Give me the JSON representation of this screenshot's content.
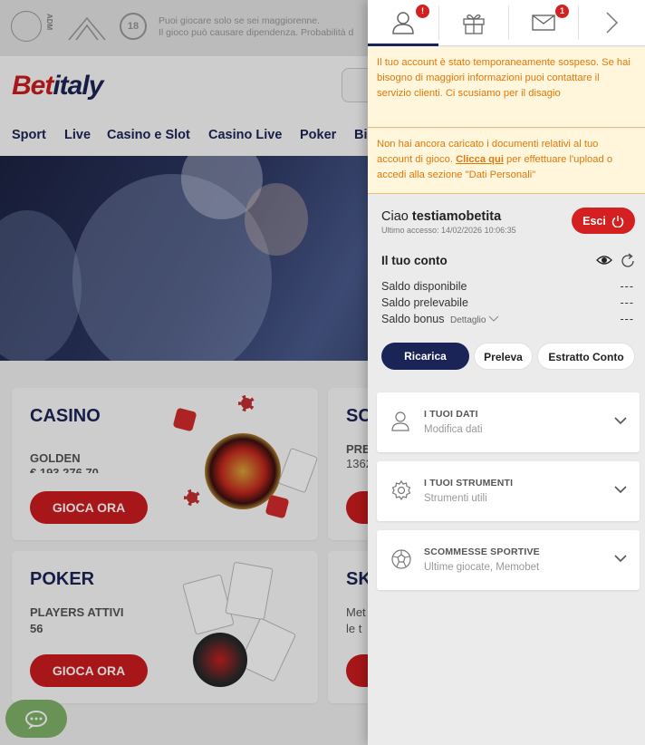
{
  "site": {
    "topbar": {
      "adm_label": "ADM",
      "age_badge": "18",
      "warning": "Puoi giocare solo se sei maggiorenne.\nIl gioco può causare dipendenza. Probabilità d"
    },
    "brand": {
      "part1": "Bet",
      "part2": "italy"
    },
    "nav": [
      "Sport",
      "Live",
      "Casino e Slot",
      "Casino Live",
      "Poker",
      "Bi"
    ],
    "cards": {
      "casino": {
        "title": "CASINO",
        "subtitle": "GOLDEN",
        "value": "€ 193.276,70",
        "button": "GIOCA ORA"
      },
      "sc": {
        "title": "SC",
        "subtitle": "PRE",
        "value": "1362"
      },
      "poker": {
        "title": "POKER",
        "subtitle": "PLAYERS ATTIVI",
        "value": "56",
        "button": "GIOCA ORA"
      },
      "sk": {
        "title": "SK",
        "line1": "Met",
        "line2": "le t"
      }
    }
  },
  "panel": {
    "tabs": [
      {
        "name": "account",
        "badge": "!"
      },
      {
        "name": "gift",
        "badge": ""
      },
      {
        "name": "messages",
        "badge": "1"
      },
      {
        "name": "next",
        "badge": ""
      }
    ],
    "notice1": "Il tuo account è stato temporaneamente sospeso. Se hai bisogno di maggiori informazioni puoi contattare il servizio clienti. Ci scusiamo per il disagio",
    "notice2": {
      "before": "Non hai ancora caricato i documenti relativi al tuo account di gioco.",
      "link": "Clicca qui",
      "after": "per effettuare l'upload o accedi alla sezione \"Dati Personali\""
    },
    "greeting": {
      "hello": "Ciao",
      "username": "testiamobetita",
      "last_access": "Ultimo accesso: 14/02/2026 10:06:35"
    },
    "logout_label": "Esci",
    "conto": {
      "title": "Il tuo conto",
      "rows": [
        {
          "label": "Saldo disponibile",
          "value": "---"
        },
        {
          "label": "Saldo prelevabile",
          "value": "---"
        },
        {
          "label": "Saldo bonus",
          "detail": "Dettaglio",
          "value": "---"
        }
      ]
    },
    "buttons": {
      "ricarica": "Ricarica",
      "preleva": "Preleva",
      "estratto": "Estratto Conto"
    },
    "sections": [
      {
        "title": "I TUOI DATI",
        "subtitle": "Modifica dati",
        "icon": "user-icon"
      },
      {
        "title": "I TUOI STRUMENTI",
        "subtitle": "Strumenti utili",
        "icon": "gear-icon"
      },
      {
        "title": "SCOMMESSE SPORTIVE",
        "subtitle": "Ultime giocate, Memobet",
        "icon": "soccer-ball-icon"
      }
    ]
  }
}
